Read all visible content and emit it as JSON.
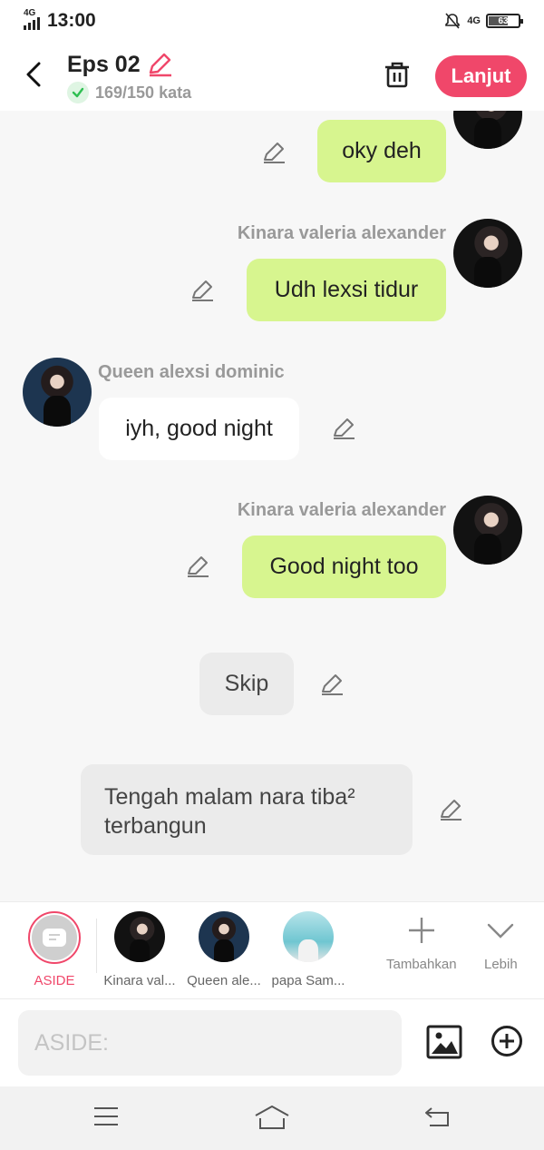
{
  "status": {
    "network_left": "4G",
    "time": "13:00",
    "network_right": "4G",
    "battery": "63"
  },
  "header": {
    "title": "Eps 02",
    "word_count": "169/150 kata",
    "next_label": "Lanjut"
  },
  "messages": [
    {
      "text": "oky deh"
    },
    {
      "name": "Kinara valeria alexander",
      "text": "Udh lexsi tidur"
    },
    {
      "name": "Queen alexsi dominic",
      "text": "iyh, good night"
    },
    {
      "name": "Kinara valeria alexander",
      "text": "Good night too"
    },
    {
      "text": "Skip"
    },
    {
      "text": "Tengah malam nara tiba² terbangun"
    }
  ],
  "characters": [
    {
      "label": "ASIDE"
    },
    {
      "label": "Kinara val..."
    },
    {
      "label": "Queen ale..."
    },
    {
      "label": "papa Sam..."
    }
  ],
  "tools": {
    "add_label": "Tambahkan",
    "more_label": "Lebih"
  },
  "composer": {
    "placeholder": "ASIDE:"
  },
  "colors": {
    "accent": "#f0476a",
    "bubble_self": "#d7f58f"
  }
}
